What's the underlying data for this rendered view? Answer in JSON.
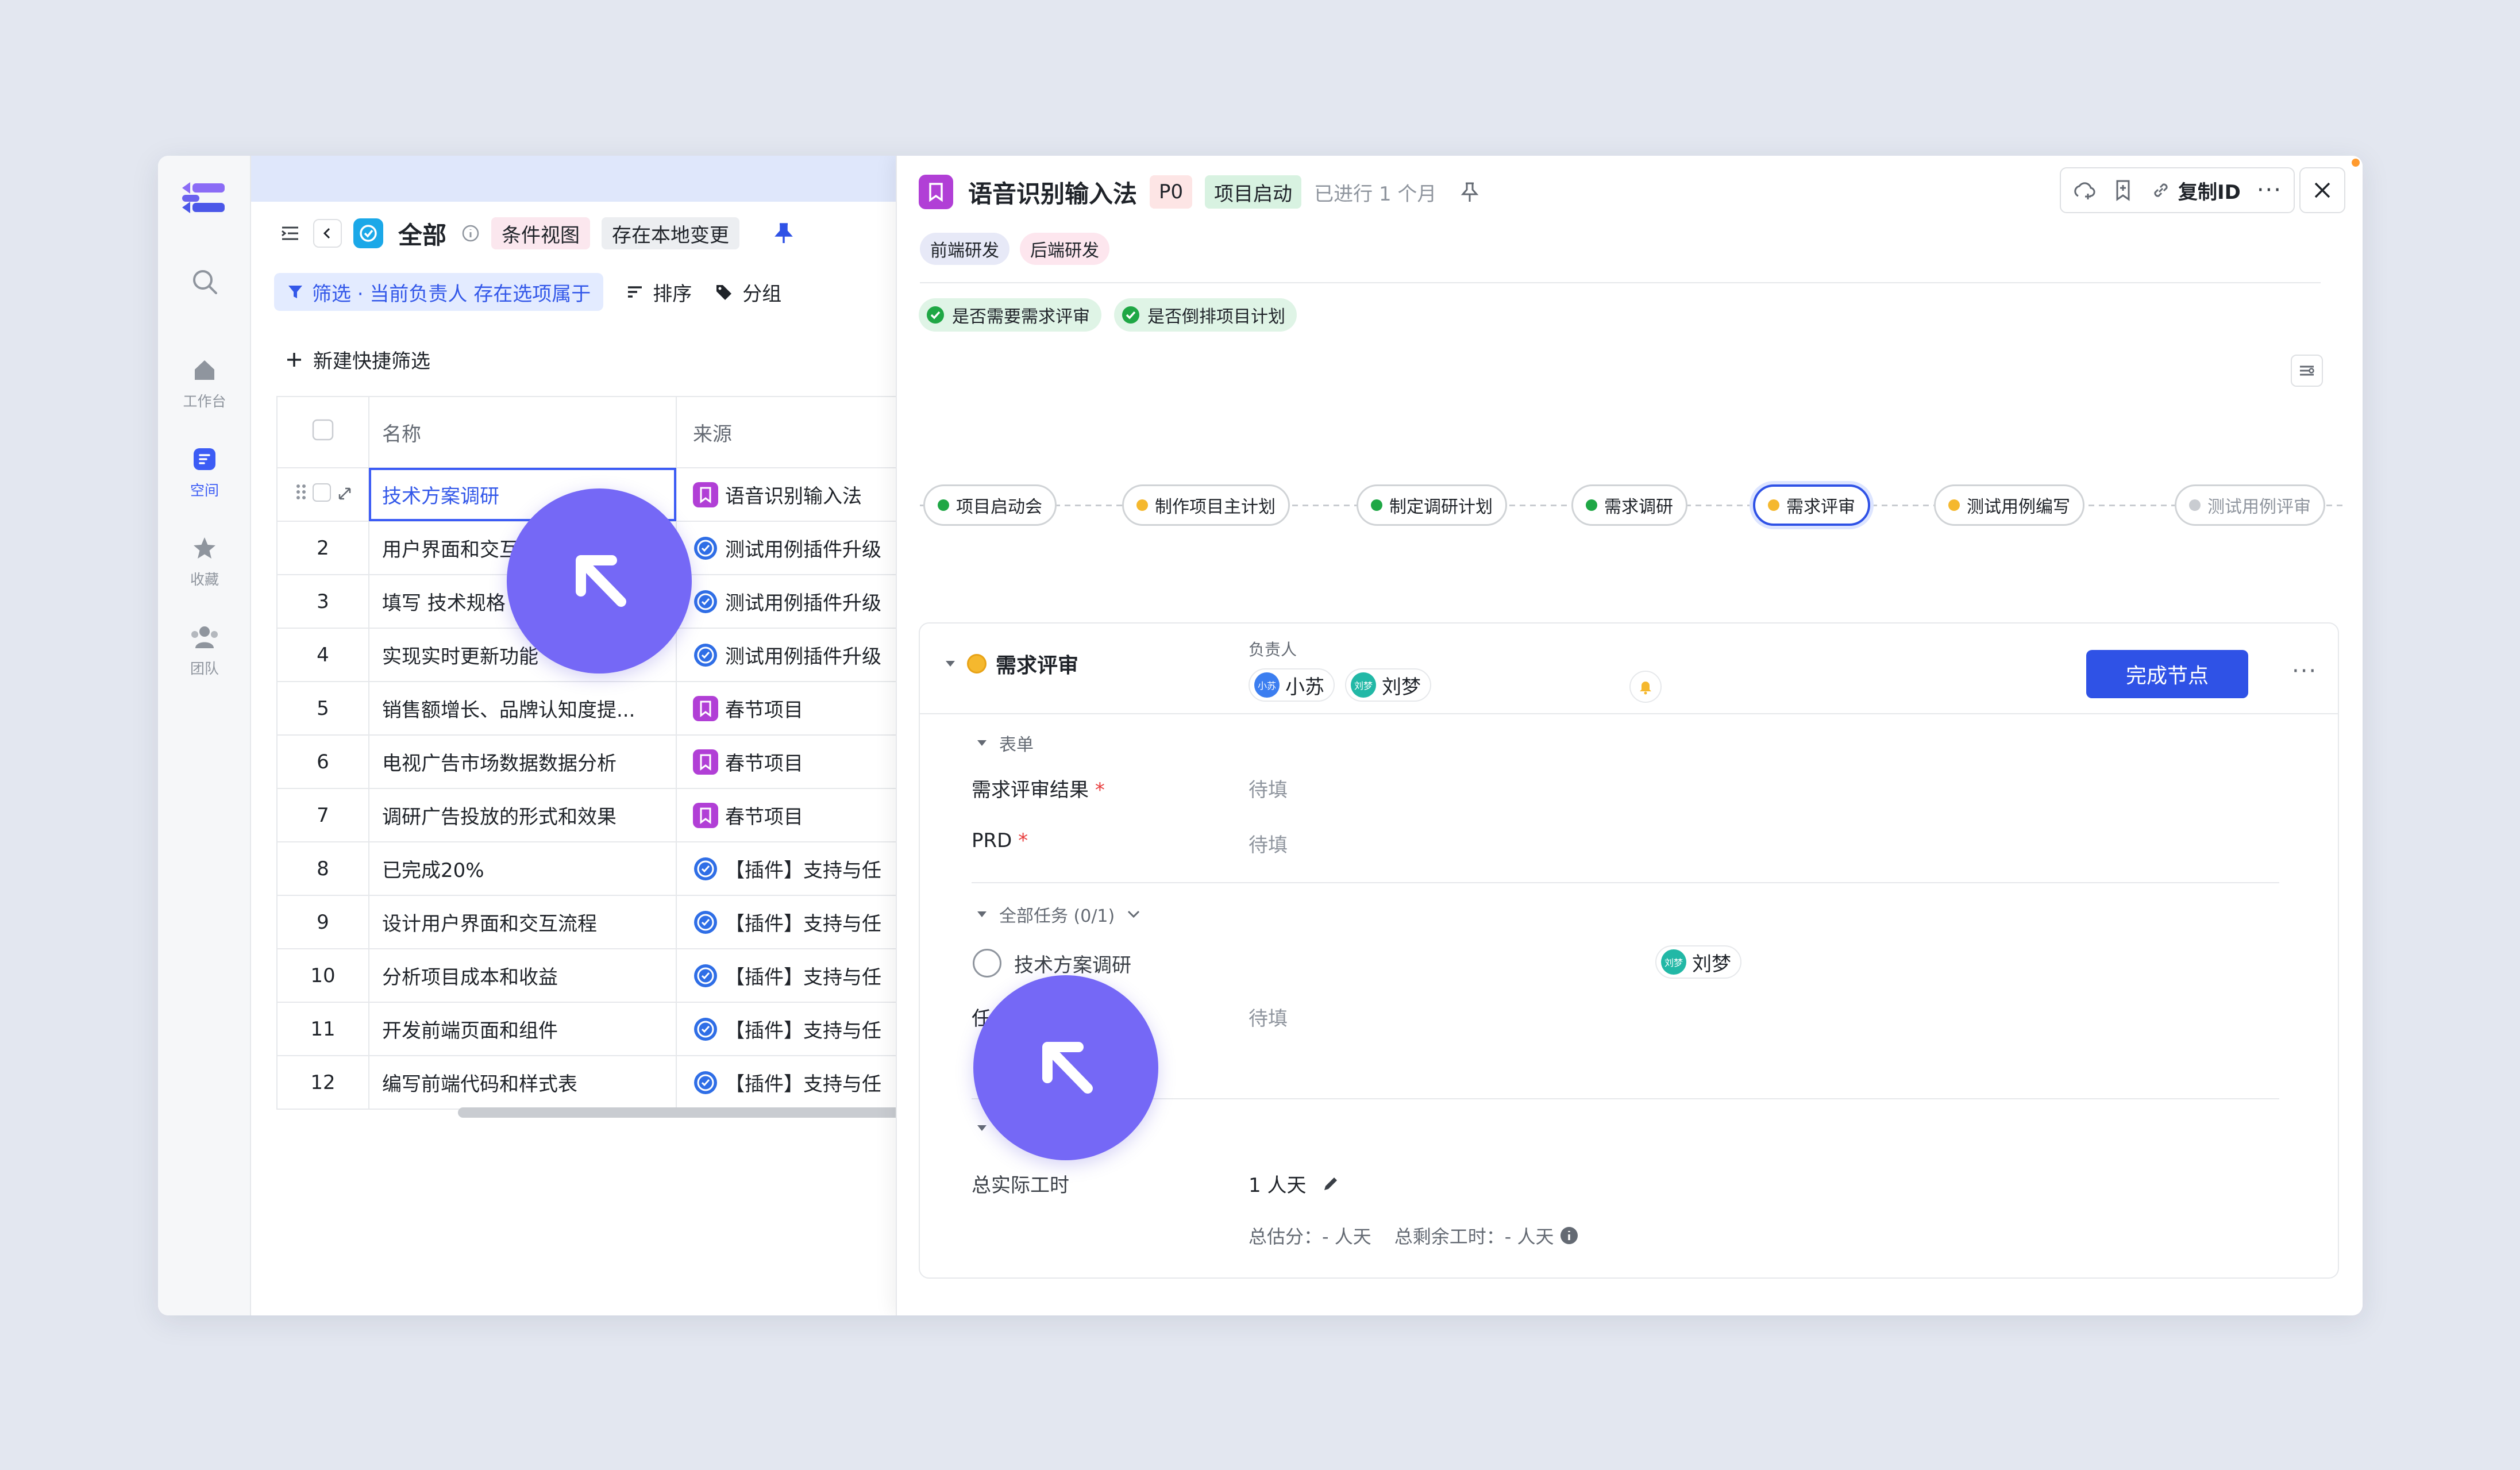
{
  "rail": {
    "items": [
      {
        "label": "工作台",
        "icon": "home-icon"
      },
      {
        "label": "空间",
        "icon": "space-icon"
      },
      {
        "label": "收藏",
        "icon": "star-icon"
      },
      {
        "label": "团队",
        "icon": "team-icon"
      }
    ]
  },
  "list": {
    "title": "全部",
    "view_label": "条件视图",
    "save_label": "存在本地变更",
    "filter_label": "筛选 · 当前负责人 存在选项属于",
    "sort_label": "排序",
    "group_label": "分组",
    "quick_filter": "新建快捷筛选",
    "columns": {
      "name": "名称",
      "source": "来源"
    },
    "rows": [
      {
        "no": "",
        "name": "技术方案调研",
        "source": "语音识别输入法",
        "src_type": "book"
      },
      {
        "no": "2",
        "name": "用户界面和交互",
        "source": "测试用例插件升级",
        "src_type": "check"
      },
      {
        "no": "3",
        "name": "填写 技术规格",
        "source": "测试用例插件升级",
        "src_type": "check"
      },
      {
        "no": "4",
        "name": "实现实时更新功能",
        "source": "测试用例插件升级",
        "src_type": "check"
      },
      {
        "no": "5",
        "name": "销售额增长、品牌认知度提...",
        "source": "春节项目",
        "src_type": "book"
      },
      {
        "no": "6",
        "name": "电视广告市场数据数据分析",
        "source": "春节项目",
        "src_type": "book"
      },
      {
        "no": "7",
        "name": "调研广告投放的形式和效果",
        "source": "春节项目",
        "src_type": "book"
      },
      {
        "no": "8",
        "name": "已完成20%",
        "source": "【插件】支持与任",
        "src_type": "check"
      },
      {
        "no": "9",
        "name": "设计用户界面和交互流程",
        "source": "【插件】支持与任",
        "src_type": "check"
      },
      {
        "no": "10",
        "name": "分析项目成本和收益",
        "source": "【插件】支持与任",
        "src_type": "check"
      },
      {
        "no": "11",
        "name": "开发前端页面和组件",
        "source": "【插件】支持与任",
        "src_type": "check"
      },
      {
        "no": "12",
        "name": "编写前端代码和样式表",
        "source": "【插件】支持与任",
        "src_type": "check"
      }
    ]
  },
  "panel": {
    "title": "语音识别输入法",
    "priority": "P0",
    "stage": "项目启动",
    "duration": "已进行 1 个月",
    "copy_id": "复制ID",
    "labels": [
      "前端研发",
      "后端研发"
    ],
    "checks": [
      "是否需要需求评审",
      "是否倒排项目计划"
    ],
    "flow": [
      {
        "label": "项目启动会",
        "status": "done",
        "color": "#1fa745"
      },
      {
        "label": "制作项目主计划",
        "status": "doing",
        "color": "#f5b82e"
      },
      {
        "label": "制定调研计划",
        "status": "done",
        "color": "#1fa745"
      },
      {
        "label": "需求调研",
        "status": "done",
        "color": "#1fa745"
      },
      {
        "label": "需求评审",
        "status": "current",
        "color": "#f5b82e"
      },
      {
        "label": "测试用例编写",
        "status": "doing",
        "color": "#f5b82e"
      },
      {
        "label": "测试用例评审",
        "status": "todo",
        "color": "#c9ccd1"
      }
    ],
    "node": {
      "name": "需求评审",
      "owner_label": "负责人",
      "owners": [
        {
          "name": "小苏",
          "avatar": "小苏",
          "color": "#3c7ef0"
        },
        {
          "name": "刘梦",
          "avatar": "刘梦",
          "color": "#22b8a6"
        }
      ],
      "complete_button": "完成节点",
      "form_section": "表单",
      "fields": [
        {
          "label": "需求评审结果",
          "required": "*",
          "value": "待填"
        },
        {
          "label": "PRD",
          "required": "*",
          "value": "待填"
        }
      ],
      "tasks_section": "全部任务 (0/1)",
      "task": {
        "name": "技术方案调研",
        "assignee": "刘梦",
        "assignee_avatar": "刘梦"
      },
      "task_field": {
        "label": "任",
        "value": "待填"
      },
      "worktime_label": "总实际工时",
      "worktime_value": "1 人天",
      "estimate": "总估分：- 人天",
      "remaining": "总剩余工时：- 人天"
    }
  },
  "colors": {
    "accent": "#2f52e6",
    "cursor": "#7568f6"
  }
}
